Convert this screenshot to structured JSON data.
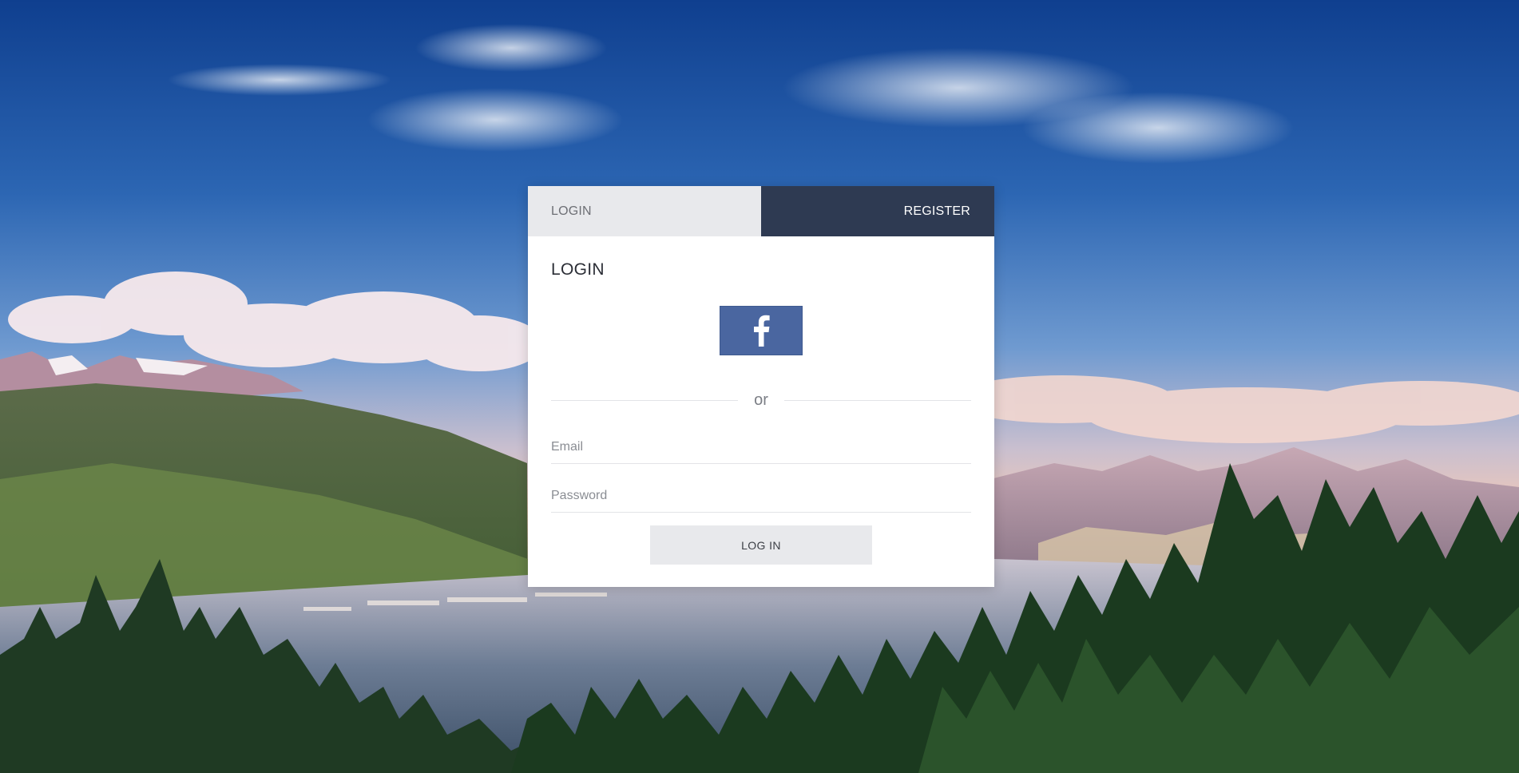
{
  "tabs": {
    "login_label": "LOGIN",
    "register_label": "REGISTER"
  },
  "form": {
    "title": "LOGIN",
    "facebook_icon": "facebook-icon",
    "divider_text": "or",
    "email_placeholder": "Email",
    "password_placeholder": "Password",
    "submit_label": "LOG IN"
  },
  "colors": {
    "register_tab": "#2e3a52",
    "login_tab": "#e8e9ec",
    "facebook": "#4a66a0",
    "submit": "#e8e9ec"
  },
  "background": {
    "scene": "mountain-lake-landscape"
  }
}
